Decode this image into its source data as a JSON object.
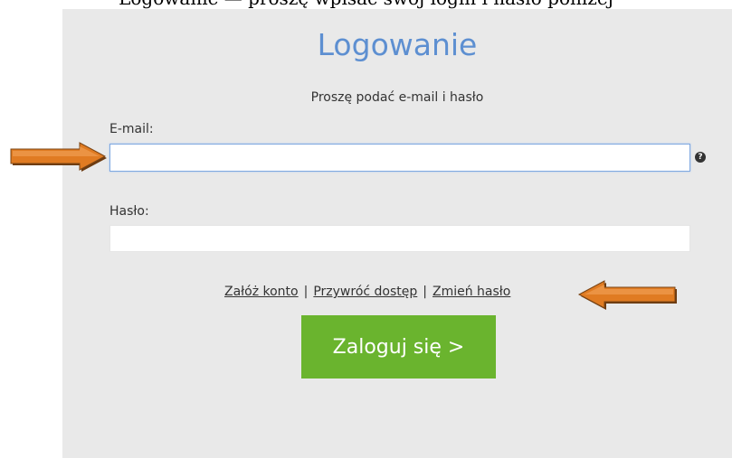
{
  "header_fragment": "Logowanie — proszę wpisać swój login i hasło poniżej",
  "login": {
    "title": "Logowanie",
    "subtitle": "Proszę podać e-mail i hasło",
    "email_label": "E-mail:",
    "email_value": "",
    "help_icon": "question-circle-icon",
    "password_label": "Hasło:",
    "password_value": "",
    "links": {
      "create_account": "Załóż konto",
      "restore_access": "Przywróć dostęp",
      "change_password": "Zmień hasło",
      "separator": "|"
    },
    "submit_label": "Zaloguj się >"
  },
  "colors": {
    "panel_bg": "#e9e9e9",
    "title": "#5d8fd1",
    "button_bg": "#6ab42e",
    "arrow_fill": "#e07b22"
  },
  "annotations": {
    "arrow_icon": "right-arrow-icon"
  }
}
